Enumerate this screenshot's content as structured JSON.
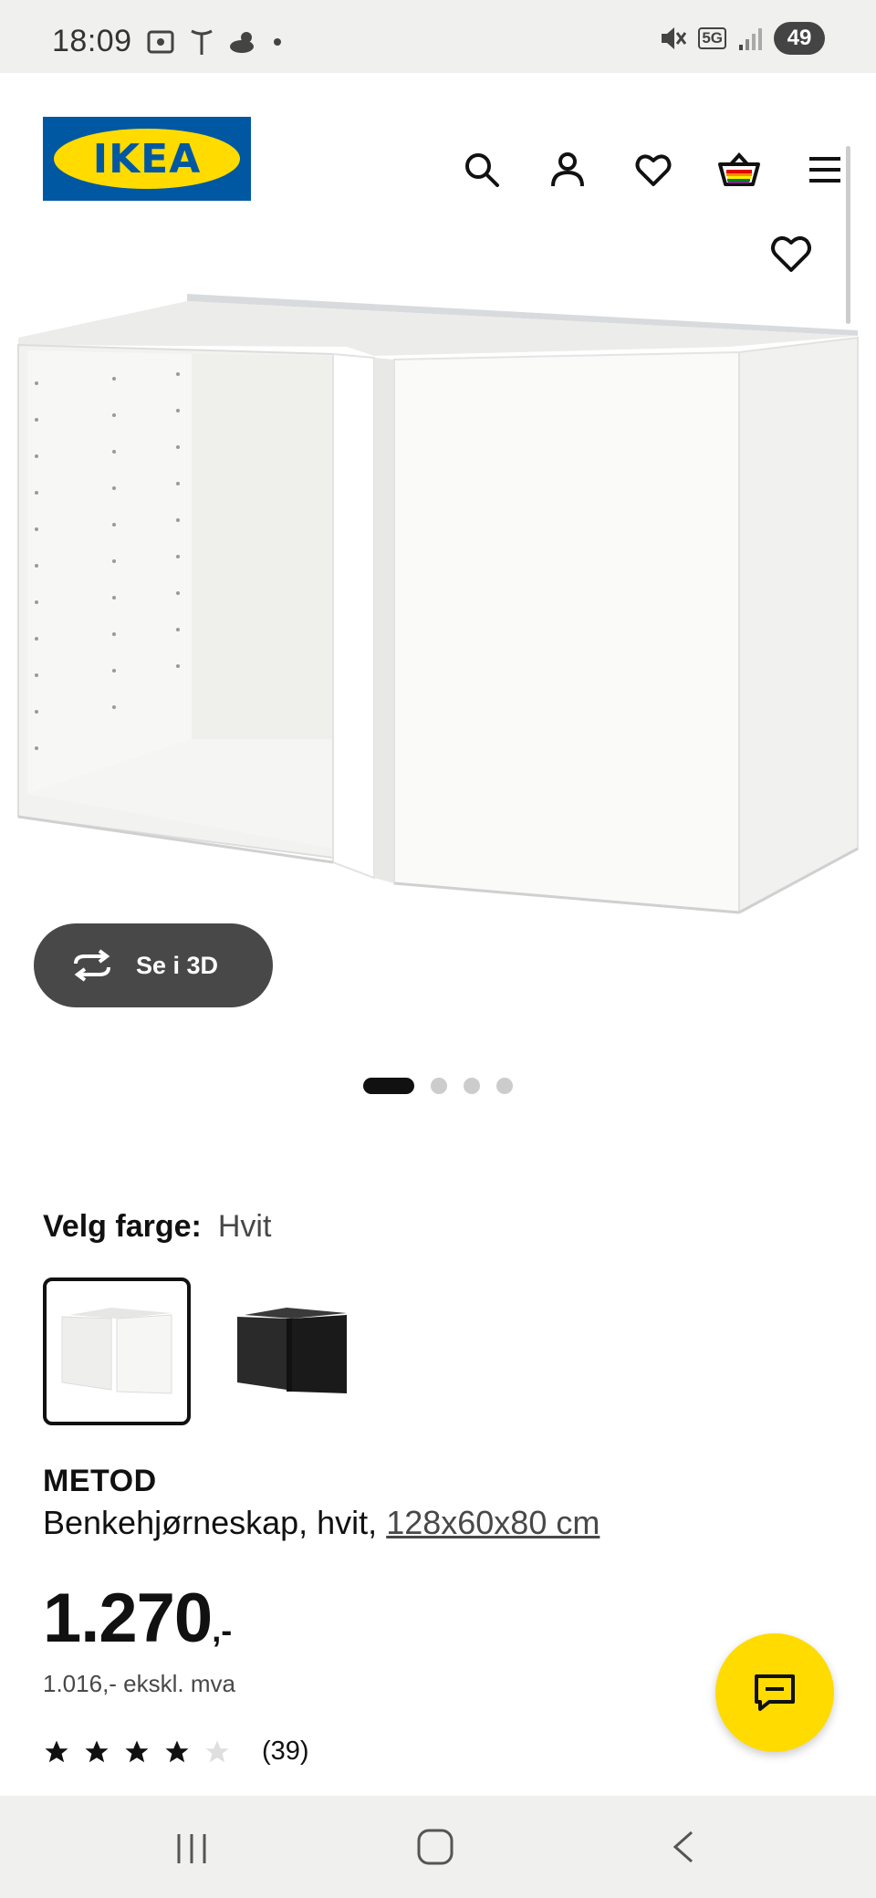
{
  "status_bar": {
    "time": "18:09",
    "network": "5G",
    "battery": "49"
  },
  "header": {
    "logo_text": "IKEA",
    "colors": {
      "logo_blue": "#0058a3",
      "logo_yellow": "#ffdb00"
    },
    "icons": [
      "search-icon",
      "account-icon",
      "favourites-icon",
      "cart-icon",
      "menu-icon"
    ]
  },
  "gallery": {
    "button_3d_label": "Se i 3D",
    "image_count": 4,
    "active_index": 0
  },
  "product": {
    "color_label": "Velg farge:",
    "color_value": "Hvit",
    "swatches": [
      {
        "name": "Hvit",
        "color": "#f4f4f2",
        "selected": true
      },
      {
        "name": "Svart",
        "color": "#1e1e1e",
        "selected": false
      }
    ],
    "name": "METOD",
    "description": "Benkehjørneskap, hvit, ",
    "size": "128x60x80 cm",
    "price": "1.270",
    "price_suffix": ",-",
    "price_ex_vat": "1.016,- ekskl. mva",
    "rating": 4,
    "review_count": "(39)"
  }
}
